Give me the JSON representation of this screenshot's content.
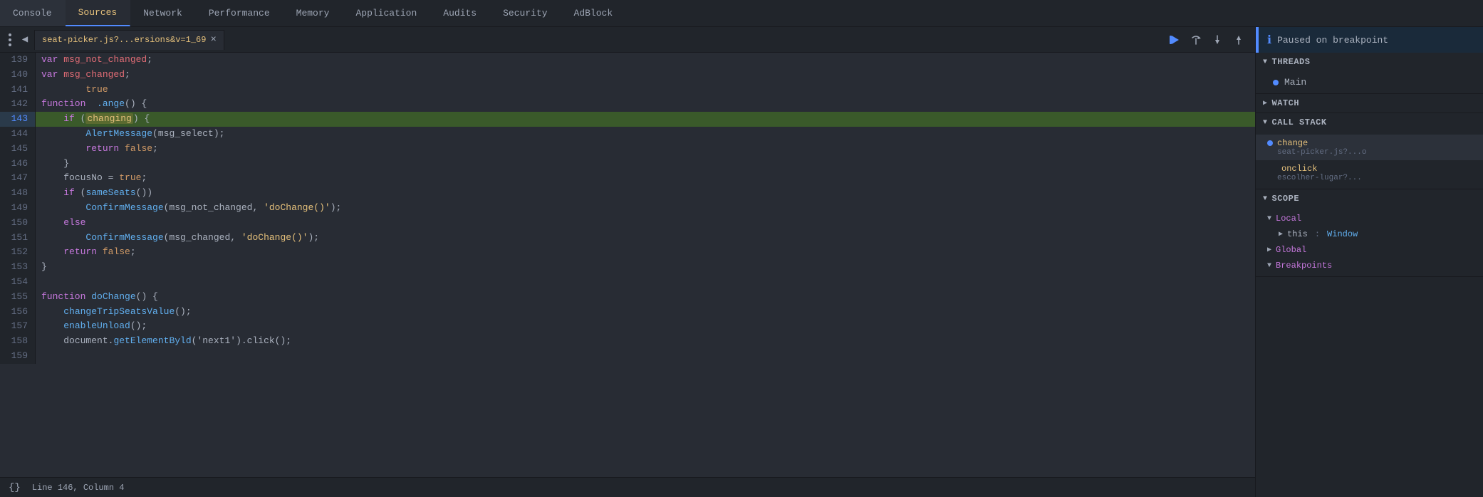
{
  "tabs": {
    "items": [
      {
        "label": "Console",
        "active": false
      },
      {
        "label": "Sources",
        "active": true
      },
      {
        "label": "Network",
        "active": false
      },
      {
        "label": "Performance",
        "active": false
      },
      {
        "label": "Memory",
        "active": false
      },
      {
        "label": "Application",
        "active": false
      },
      {
        "label": "Audits",
        "active": false
      },
      {
        "label": "Security",
        "active": false
      },
      {
        "label": "AdBlock",
        "active": false
      }
    ]
  },
  "source_tab": {
    "filename": "seat-picker.js?...ersions&v=1_69",
    "close_icon": "×"
  },
  "paused_banner": {
    "text": "Paused on breakpoint",
    "icon": "ℹ"
  },
  "threads": {
    "label": "Threads",
    "items": [
      {
        "label": "Main",
        "active": true
      }
    ]
  },
  "watch": {
    "label": "Watch"
  },
  "call_stack": {
    "label": "Call Stack",
    "items": [
      {
        "fn": "change",
        "src": "seat-picker.js?...o",
        "active": true
      },
      {
        "fn": "onclick",
        "src": "escolher-lugar?...",
        "active": false
      }
    ]
  },
  "scope": {
    "label": "Scope",
    "sections": [
      {
        "label": "Local",
        "open": true
      },
      {
        "label": "this",
        "value": "Window",
        "indent": true
      },
      {
        "label": "Global",
        "open": false
      },
      {
        "label": "Breakpoints",
        "open": false
      }
    ]
  },
  "code": {
    "lines": [
      {
        "num": 139,
        "content": "var msg_not_changed;",
        "type": "normal"
      },
      {
        "num": 140,
        "content": "var msg_changed;",
        "type": "normal"
      },
      {
        "num": 141,
        "content": "        true",
        "type": "normal"
      },
      {
        "num": 142,
        "content": "function  .ange() {",
        "type": "normal"
      },
      {
        "num": 143,
        "content": "    if (changing) {",
        "type": "highlighted",
        "breakpoint": true
      },
      {
        "num": 144,
        "content": "        AlertMessage(msg_select);",
        "type": "normal"
      },
      {
        "num": 145,
        "content": "        return false;",
        "type": "normal"
      },
      {
        "num": 146,
        "content": "    }",
        "type": "normal"
      },
      {
        "num": 147,
        "content": "    focusNo = true;",
        "type": "normal"
      },
      {
        "num": 148,
        "content": "    if (sameSeats())",
        "type": "normal"
      },
      {
        "num": 149,
        "content": "        ConfirmMessage(msg_not_changed, 'doChange()');",
        "type": "normal"
      },
      {
        "num": 150,
        "content": "    else",
        "type": "normal"
      },
      {
        "num": 151,
        "content": "        ConfirmMessage(msg_changed, 'doChange()');",
        "type": "normal"
      },
      {
        "num": 152,
        "content": "    return false;",
        "type": "normal"
      },
      {
        "num": 153,
        "content": "}",
        "type": "normal"
      },
      {
        "num": 154,
        "content": "",
        "type": "normal"
      },
      {
        "num": 155,
        "content": "function doChange() {",
        "type": "normal"
      },
      {
        "num": 156,
        "content": "    changeTripSeatsValue();",
        "type": "normal"
      },
      {
        "num": 157,
        "content": "    enableUnload();",
        "type": "normal"
      },
      {
        "num": 158,
        "content": "    document.getElementByld('next1').click();",
        "type": "normal"
      },
      {
        "num": 159,
        "content": "",
        "type": "normal"
      }
    ]
  },
  "status_bar": {
    "label": "Line 146, Column 4",
    "icon": "{}"
  }
}
